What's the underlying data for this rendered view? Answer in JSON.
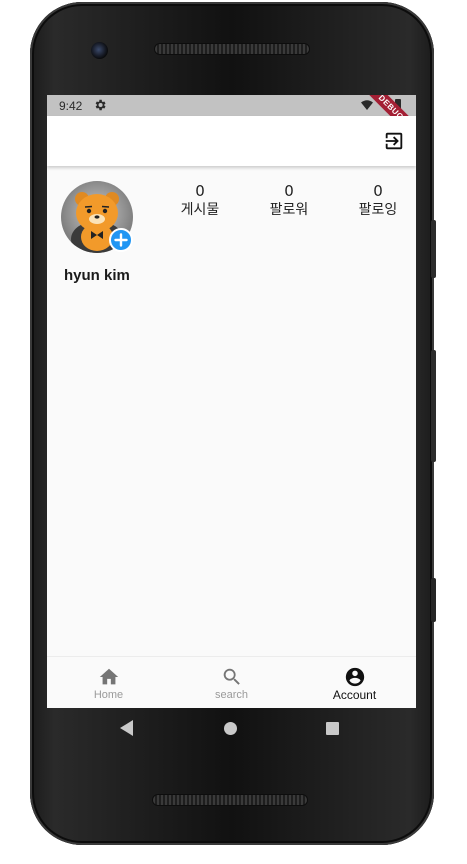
{
  "status_bar": {
    "time": "9:42",
    "debug_label": "DEBUG"
  },
  "app_bar": {
    "logout_icon": "logout-icon"
  },
  "profile": {
    "username": "hyun kim",
    "avatar_icon": "bear-avatar",
    "add_icon": "add-circle-icon",
    "accent_color": "#2196f3",
    "stats": [
      {
        "value": "0",
        "label": "게시물"
      },
      {
        "value": "0",
        "label": "팔로워"
      },
      {
        "value": "0",
        "label": "팔로잉"
      }
    ]
  },
  "bottom_nav": {
    "items": [
      {
        "label": "Home",
        "icon": "home-icon",
        "active": false
      },
      {
        "label": "search",
        "icon": "search-icon",
        "active": false
      },
      {
        "label": "Account",
        "icon": "account-circle-icon",
        "active": true
      }
    ]
  }
}
